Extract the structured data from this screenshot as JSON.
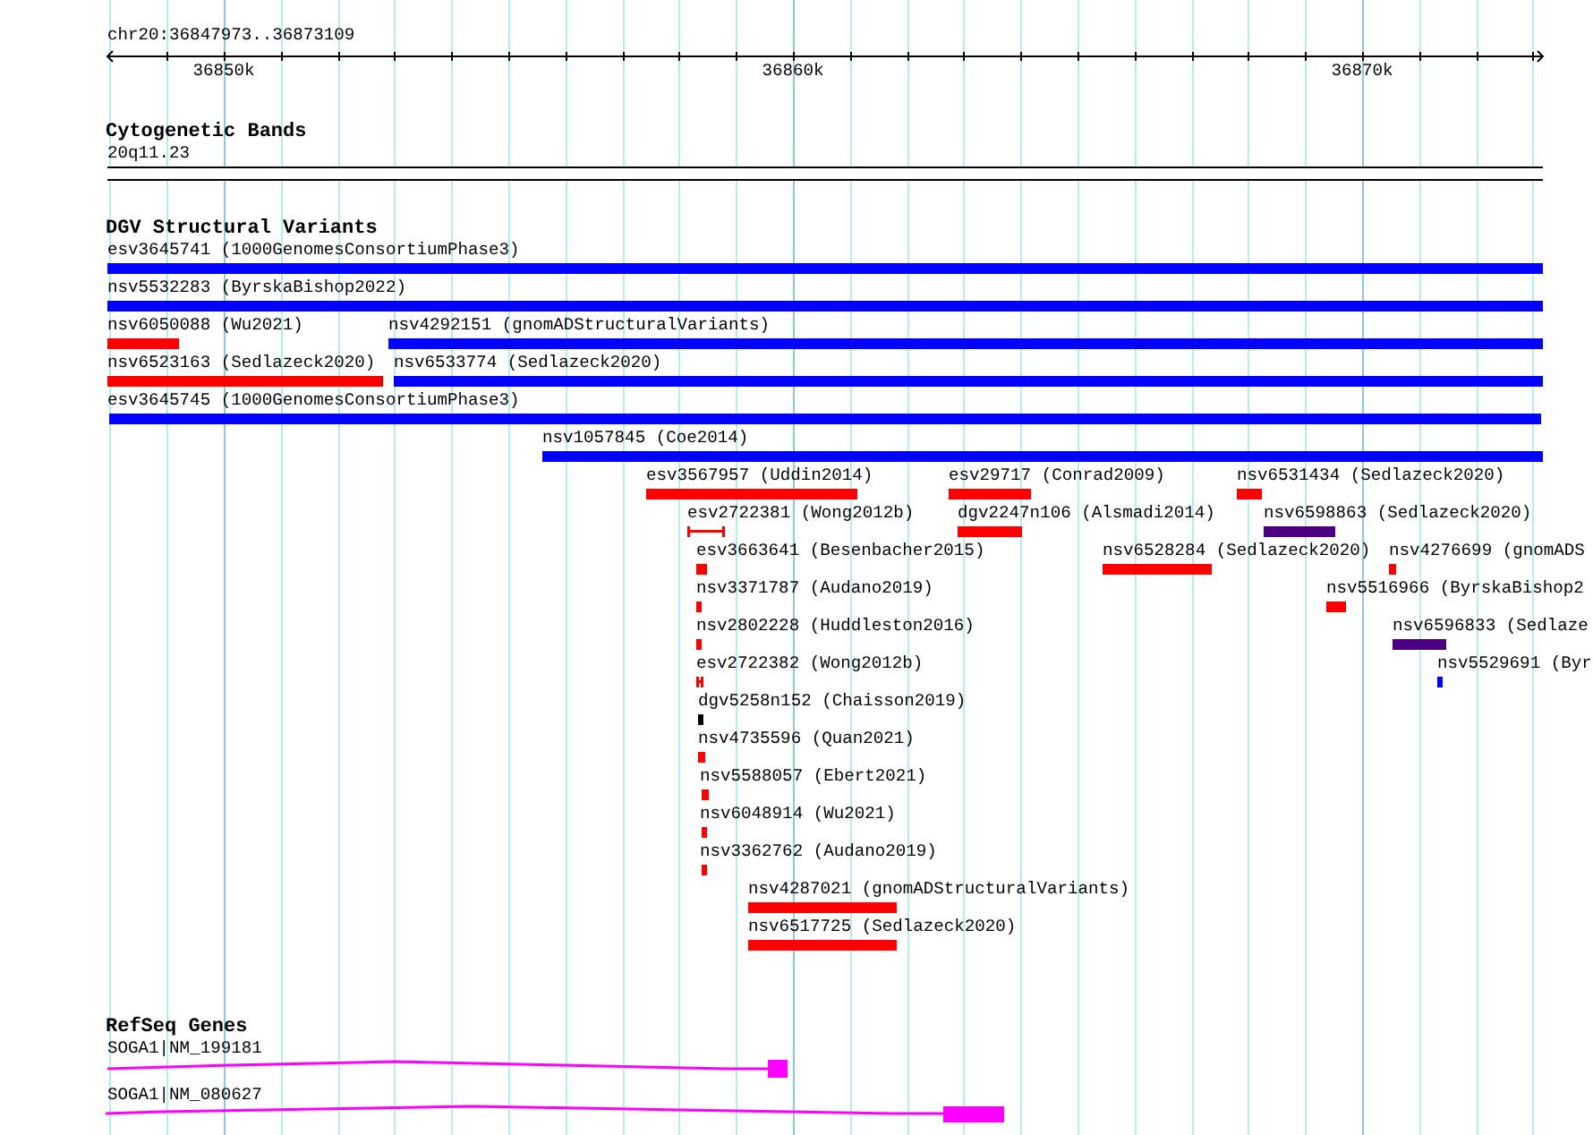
{
  "ruler": {
    "location": "chr20:36847973..36873109",
    "ticks": [
      {
        "label": "36850k"
      },
      {
        "label": "36860k"
      },
      {
        "label": "36870k"
      }
    ]
  },
  "tracks": [
    {
      "title": "Cytogenetic Bands",
      "features": [
        {
          "kind": "band",
          "label": "20q11.23"
        }
      ]
    },
    {
      "title": "DGV Structural Variants",
      "features": [
        {
          "kind": "bar",
          "label": "esv3645741 (1000GenomesConsortiumPhase3)",
          "color": "#0000ff"
        },
        {
          "kind": "bar",
          "label": "nsv5532283 (ByrskaBishop2022)",
          "color": "#0000ff"
        },
        {
          "kind": "bar",
          "label": "nsv6050088 (Wu2021)",
          "color": "#ff0000"
        },
        {
          "kind": "bar",
          "label": "nsv4292151 (gnomADStructuralVariants)",
          "color": "#0000ff"
        },
        {
          "kind": "bar",
          "label": "nsv6523163 (Sedlazeck2020)",
          "color": "#ff0000"
        },
        {
          "kind": "bar",
          "label": "nsv6533774 (Sedlazeck2020)",
          "color": "#0000ff"
        },
        {
          "kind": "bar",
          "label": "esv3645745 (1000GenomesConsortiumPhase3)",
          "color": "#0000ff"
        },
        {
          "kind": "bar",
          "label": "nsv1057845 (Coe2014)",
          "color": "#0000ff"
        },
        {
          "kind": "bar",
          "label": "esv3567957 (Uddin2014)",
          "color": "#ff0000"
        },
        {
          "kind": "bar",
          "label": "esv29717 (Conrad2009)",
          "color": "#ff0000"
        },
        {
          "kind": "bar",
          "label": "nsv6531434 (Sedlazeck2020)",
          "color": "#ff0000"
        },
        {
          "kind": "interval",
          "label": "esv2722381 (Wong2012b)",
          "color": "#ff0000"
        },
        {
          "kind": "bar",
          "label": "dgv2247n106 (Alsmadi2014)",
          "color": "#ff0000"
        },
        {
          "kind": "bar",
          "label": "nsv6598863 (Sedlazeck2020)",
          "color": "#4b0082"
        },
        {
          "kind": "bar",
          "label": "esv3663641 (Besenbacher2015)",
          "color": "#ff0000"
        },
        {
          "kind": "bar",
          "label": "nsv6528284 (Sedlazeck2020)",
          "color": "#ff0000"
        },
        {
          "kind": "bar",
          "label": "nsv4276699 (gnomADS",
          "color": "#ff0000"
        },
        {
          "kind": "bar",
          "label": "nsv3371787 (Audano2019)",
          "color": "#ff0000"
        },
        {
          "kind": "bar",
          "label": "nsv5516966 (ByrskaBishop2",
          "color": "#ff0000"
        },
        {
          "kind": "bar",
          "label": "nsv2802228 (Huddleston2016)",
          "color": "#ff0000"
        },
        {
          "kind": "bar",
          "label": "nsv6596833 (Sedlaze",
          "color": "#4b0082"
        },
        {
          "kind": "interval",
          "label": "esv2722382 (Wong2012b)",
          "color": "#ff0000"
        },
        {
          "kind": "bar",
          "label": "nsv5529691 (Byr",
          "color": "#0000ff"
        },
        {
          "kind": "bar",
          "label": "dgv5258n152 (Chaisson2019)",
          "color": "#000000"
        },
        {
          "kind": "bar",
          "label": "nsv4735596 (Quan2021)",
          "color": "#ff0000"
        },
        {
          "kind": "bar",
          "label": "nsv5588057 (Ebert2021)",
          "color": "#ff0000"
        },
        {
          "kind": "bar",
          "label": "nsv6048914 (Wu2021)",
          "color": "#ff0000"
        },
        {
          "kind": "bar",
          "label": "nsv3362762 (Audano2019)",
          "color": "#ff0000"
        },
        {
          "kind": "bar",
          "label": "nsv4287021 (gnomADStructuralVariants)",
          "color": "#ff0000"
        },
        {
          "kind": "bar",
          "label": "nsv6517725 (Sedlazeck2020)",
          "color": "#ff0000"
        }
      ]
    },
    {
      "title": "RefSeq Genes",
      "features": [
        {
          "kind": "gene",
          "label": "SOGA1|NM_199181",
          "color": "#ff00ff"
        },
        {
          "kind": "gene",
          "label": "SOGA1|NM_080627",
          "color": "#ff00ff"
        }
      ]
    }
  ]
}
